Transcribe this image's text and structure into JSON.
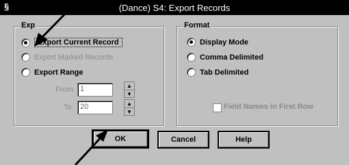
{
  "window": {
    "title": "(Dance) S4: Export Records",
    "icon": "app-icon"
  },
  "export_group": {
    "title": "Exp",
    "options": [
      {
        "label": "Export Current Record",
        "checked": true,
        "enabled": true,
        "focused": true
      },
      {
        "label": "Export Marked Records",
        "checked": false,
        "enabled": false
      },
      {
        "label": "Export Range",
        "checked": false,
        "enabled": true
      }
    ],
    "from_label": "From:",
    "from_value": "1",
    "to_label": "To:",
    "to_value": "20"
  },
  "format_group": {
    "title": "Format",
    "options": [
      {
        "label": "Display Mode",
        "checked": true
      },
      {
        "label": "Comma Delimited",
        "checked": false
      },
      {
        "label": "Tab Delimited",
        "checked": false
      }
    ],
    "field_names_label": "Field Names in First Row",
    "field_names_checked": false,
    "field_names_enabled": false
  },
  "buttons": {
    "ok": "OK",
    "cancel": "Cancel",
    "help": "Help"
  }
}
